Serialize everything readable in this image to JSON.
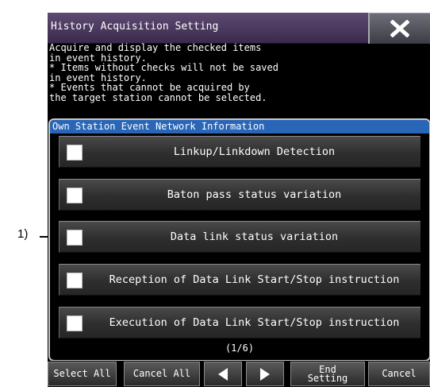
{
  "callout": "1)",
  "window": {
    "title": "History Acquisition Setting"
  },
  "description": "Acquire and display the checked items\nin event history.\n* Items without checks will not be saved\nin event history.\n* Events that cannot be acquired by\nthe target station cannot be selected.",
  "group": {
    "header": "Own Station Event Network Information",
    "items": [
      {
        "label": "Linkup/Linkdown Detection",
        "checked": false
      },
      {
        "label": "Baton pass status variation",
        "checked": false
      },
      {
        "label": "Data link status variation",
        "checked": false
      },
      {
        "label": "Reception of Data Link Start/Stop instruction",
        "checked": false
      },
      {
        "label": "Execution of Data Link Start/Stop instruction",
        "checked": false
      }
    ],
    "page": "(1/6)"
  },
  "toolbar": {
    "select_all": "Select All",
    "cancel_all": "Cancel All",
    "end_setting_line1": "End",
    "end_setting_line2": "Setting",
    "cancel": "Cancel"
  },
  "icons": {
    "close": "close-icon",
    "prev": "triangle-left-icon",
    "next": "triangle-right-icon"
  }
}
